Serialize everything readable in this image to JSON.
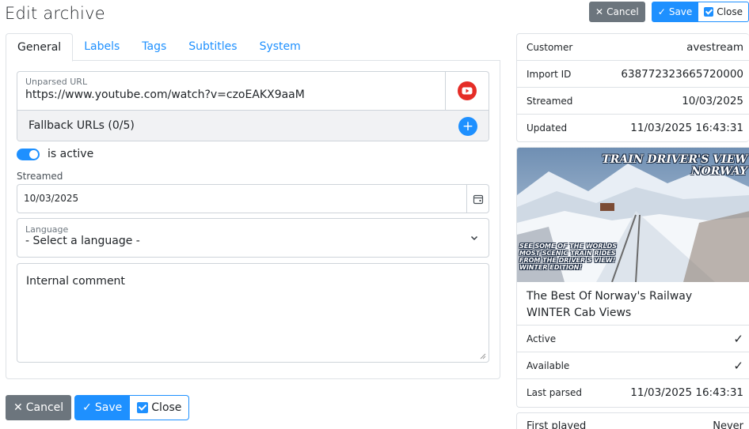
{
  "page": {
    "title": "Edit archive"
  },
  "actions": {
    "cancel": "Cancel",
    "save": "Save",
    "close": "Close"
  },
  "tabs": [
    {
      "label": "General",
      "active": true
    },
    {
      "label": "Labels",
      "active": false
    },
    {
      "label": "Tags",
      "active": false
    },
    {
      "label": "Subtitles",
      "active": false
    },
    {
      "label": "System",
      "active": false
    }
  ],
  "form": {
    "url": {
      "label": "Unparsed URL",
      "value": "https://www.youtube.com/watch?v=czoEAKX9aaM",
      "icon": "youtube-icon"
    },
    "fallback": {
      "label": "Fallback URLs (0/5)",
      "icon": "plus-icon"
    },
    "active_toggle": {
      "label": "is active",
      "checked": true
    },
    "streamed": {
      "label": "Streamed",
      "value": "10/03/2025",
      "icon": "calendar-icon"
    },
    "language": {
      "label": "Language",
      "value": "- Select a language -",
      "icon": "chevron-down-icon"
    },
    "comment": {
      "placeholder": "Internal comment"
    }
  },
  "info": {
    "rows": [
      {
        "key": "Customer",
        "value": "avestream"
      },
      {
        "key": "Import ID",
        "value": "638772323665720000"
      },
      {
        "key": "Streamed",
        "value": "10/03/2025"
      },
      {
        "key": "Updated",
        "value": "11/03/2025 16:43:31"
      }
    ]
  },
  "video": {
    "thumbnail_title_line1": "TRAIN DRIVER'S VIEW",
    "thumbnail_title_line2": "NORWAY",
    "thumbnail_caption_line1": "SEE SOME OF THE WORLDS",
    "thumbnail_caption_line2": "MOST SCENIC TRAIN RIDES",
    "thumbnail_caption_line3": "FROM THE DRIVER'S VIEW!",
    "thumbnail_caption_line4": "WINTER EDITION!",
    "title": "The Best Of Norway's Railway WINTER Cab Views",
    "rows": [
      {
        "key": "Active",
        "value": "✓"
      },
      {
        "key": "Available",
        "value": "✓"
      },
      {
        "key": "Last parsed",
        "value": "11/03/2025 16:43:31"
      }
    ]
  },
  "partial_row": {
    "key": "First played",
    "value": "Never"
  },
  "colors": {
    "primary": "#1e90ff",
    "secondary": "#6c757d",
    "youtube": "#e52d27"
  }
}
